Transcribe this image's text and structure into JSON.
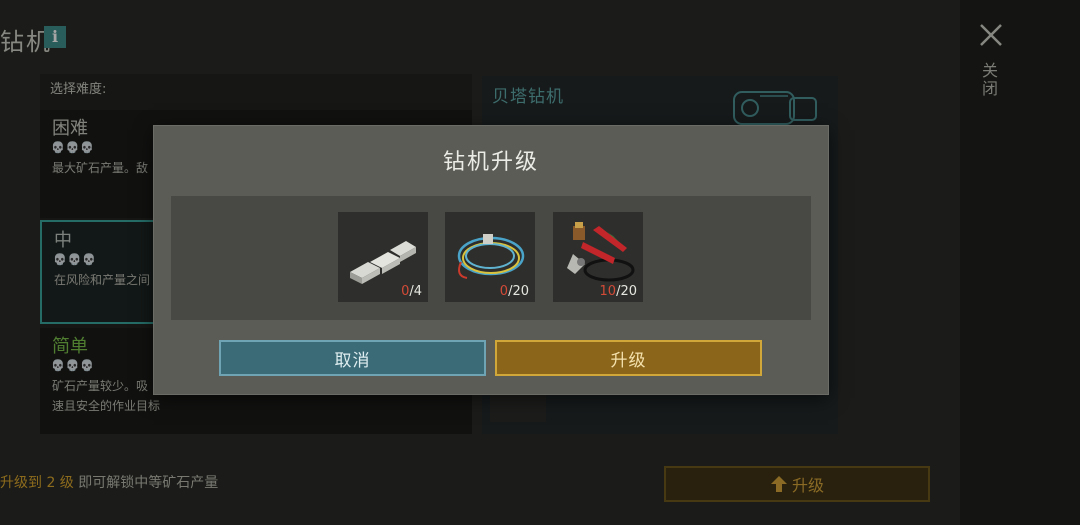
{
  "header": {
    "title": "钻机",
    "info_icon": "i"
  },
  "close": {
    "label": "关闭",
    "icon": "close-icon"
  },
  "difficulty": {
    "header": "选择难度:",
    "options": [
      {
        "name": "困难",
        "skulls": "💀💀💀",
        "desc": "最大矿石产量。敌",
        "color": "#c8c8c0"
      },
      {
        "name": "中",
        "skulls": "💀💀💀",
        "desc": "在风险和产量之间",
        "color": "#bfc7c2",
        "selected": true
      },
      {
        "name": "简单",
        "skulls": "💀💀💀",
        "desc_line1": "矿石产量较少。吸",
        "desc_line2": "速且安全的作业目标",
        "color": "#7bc24a"
      }
    ]
  },
  "drill": {
    "name": "贝塔钻机"
  },
  "footer": {
    "unlock_prefix": "升级到",
    "unlock_level": "2 级",
    "unlock_suffix": "即可解锁中等矿石产量",
    "upgrade_label": "升级"
  },
  "dialog": {
    "title": "钻机升级",
    "materials": [
      {
        "icon": "metal-ingot-icon",
        "have": "0",
        "need": "/4"
      },
      {
        "icon": "wire-coil-icon",
        "have": "0",
        "need": "/20"
      },
      {
        "icon": "pliers-tools-icon",
        "have": "10",
        "need": "/20"
      }
    ],
    "cancel_label": "取消",
    "upgrade_label": "升级"
  },
  "colors": {
    "accent_teal": "#3aa69e",
    "upgrade_gold": "#d1a73a",
    "cancel_blue": "#3c6b78",
    "shortage_red": "#d34a37",
    "easy_green": "#7bc24a"
  }
}
